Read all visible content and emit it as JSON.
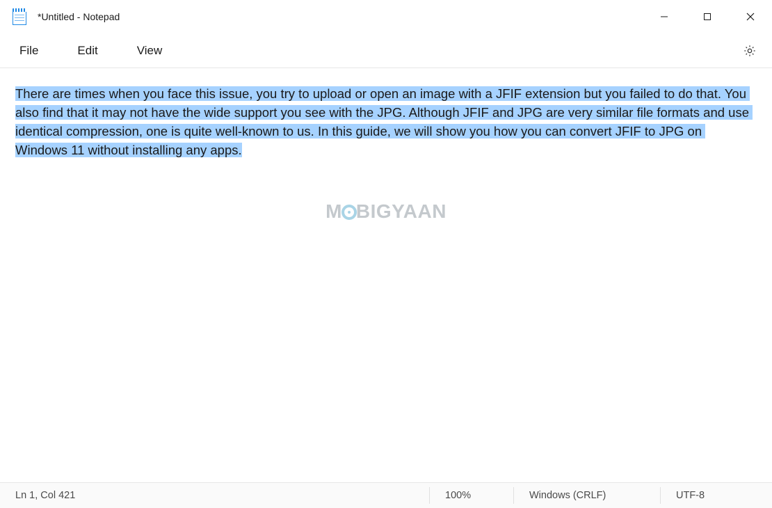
{
  "window": {
    "title": "*Untitled - Notepad"
  },
  "menu": {
    "file": "File",
    "edit": "Edit",
    "view": "View"
  },
  "editor": {
    "text": "There are times when you face this issue, you try to upload or open an image with a JFIF extension but you failed to do that. You also find that it may not have the wide support you see with the JPG. Although JFIF and JPG are very similar file formats and use identical compression, one is quite well-known to us. In this guide, we will show you how you can convert JFIF to JPG on Windows 11 without installing any apps.",
    "selection_highlight": "#a6d2ff"
  },
  "watermark": {
    "prefix": "M",
    "suffix": "BIGYAAN"
  },
  "statusbar": {
    "cursor": "Ln 1, Col 421",
    "zoom": "100%",
    "line_ending": "Windows (CRLF)",
    "encoding": "UTF-8"
  },
  "icons": {
    "minimize": "minimize-icon",
    "maximize": "maximize-icon",
    "close": "close-icon",
    "settings": "gear-icon",
    "app": "notepad-icon"
  }
}
